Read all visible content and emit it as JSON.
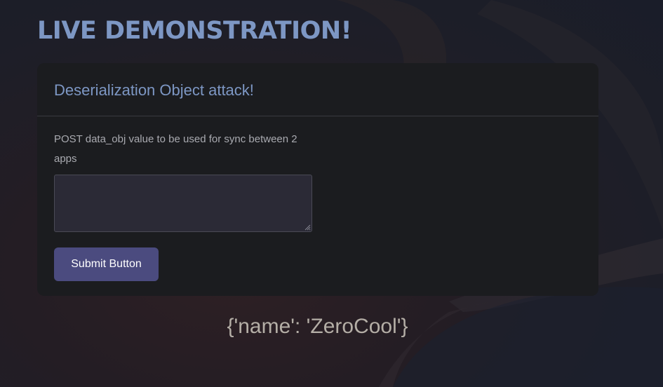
{
  "page": {
    "title": "LIVE DEMONSTRATION!"
  },
  "card": {
    "title": "Deserialization Object attack!",
    "field_label": "POST data_obj value to be used for sync between 2 apps",
    "textarea_value": "",
    "submit_label": "Submit Button"
  },
  "result": {
    "text": "{'name': 'ZeroCool'}"
  },
  "colors": {
    "accent": "#7d97c4",
    "button": "#4b4b7f",
    "card_background": "#1b1c1f"
  }
}
